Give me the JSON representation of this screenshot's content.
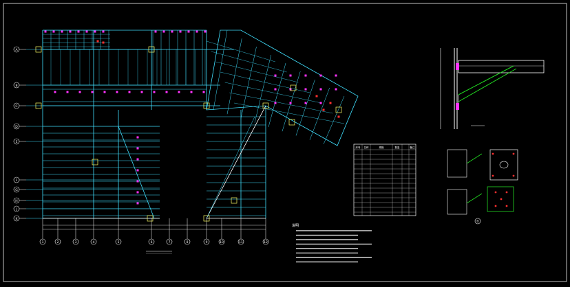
{
  "canvas": {
    "background": "#000000",
    "frame_color": "#bfbfbf"
  },
  "colors": {
    "grid": "#40e0ff",
    "beam": "#ffffff",
    "magenta": "#ff33ff",
    "red": "#ff3030",
    "green": "#22dd22",
    "yellow": "#ffff66",
    "cyan": "#00ffff"
  },
  "plan": {
    "row_axis_labels": [
      "A",
      "B",
      "C",
      "D",
      "E",
      "F",
      "G",
      "H",
      "J",
      "K"
    ],
    "col_axis_labels": [
      "1",
      "2",
      "3",
      "4",
      "5",
      "6",
      "7",
      "8",
      "9",
      "10",
      "11",
      "12"
    ]
  },
  "detail": {
    "callout_label": "①"
  },
  "table": {
    "header": [
      "序号",
      "名称",
      "规格",
      "数量",
      "备注"
    ]
  },
  "notes": {
    "heading": "说明"
  }
}
